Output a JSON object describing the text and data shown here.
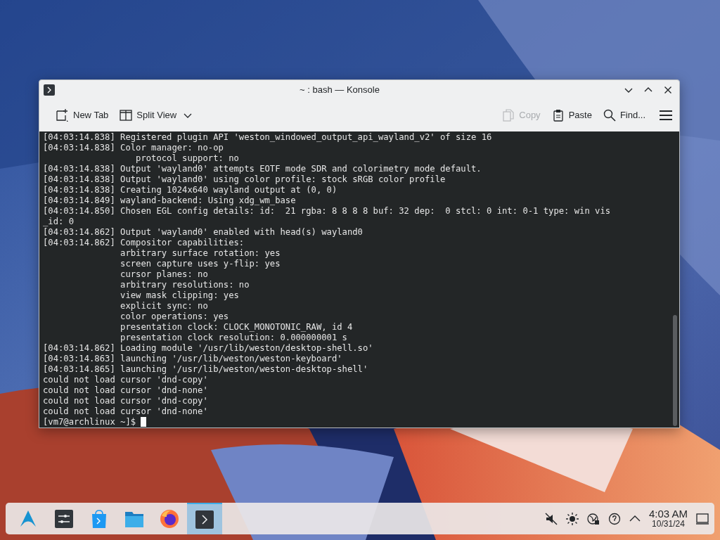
{
  "window": {
    "title": "~ : bash — Konsole"
  },
  "toolbar": [
    {
      "label": "New Tab",
      "disabled": false
    },
    {
      "label": "Split View",
      "disabled": false
    },
    {
      "label": "Copy",
      "disabled": true
    },
    {
      "label": "Paste",
      "disabled": false
    },
    {
      "label": "Find...",
      "disabled": false
    }
  ],
  "terminal": {
    "lines": [
      "[04:03:14.838] Registered plugin API 'weston_windowed_output_api_wayland_v2' of size 16",
      "[04:03:14.838] Color manager: no-op",
      "                  protocol support: no",
      "[04:03:14.838] Output 'wayland0' attempts EOTF mode SDR and colorimetry mode default.",
      "[04:03:14.838] Output 'wayland0' using color profile: stock sRGB color profile",
      "[04:03:14.838] Creating 1024x640 wayland output at (0, 0)",
      "[04:03:14.849] wayland-backend: Using xdg_wm_base",
      "[04:03:14.850] Chosen EGL config details: id:  21 rgba: 8 8 8 8 buf: 32 dep:  0 stcl: 0 int: 0-1 type: win vis",
      "_id: 0",
      "[04:03:14.862] Output 'wayland0' enabled with head(s) wayland0",
      "[04:03:14.862] Compositor capabilities:",
      "               arbitrary surface rotation: yes",
      "               screen capture uses y-flip: yes",
      "               cursor planes: no",
      "               arbitrary resolutions: no",
      "               view mask clipping: yes",
      "               explicit sync: no",
      "               color operations: yes",
      "               presentation clock: CLOCK_MONOTONIC_RAW, id 4",
      "               presentation clock resolution: 0.000000001 s",
      "[04:03:14.862] Loading module '/usr/lib/weston/desktop-shell.so'",
      "[04:03:14.863] launching '/usr/lib/weston/weston-keyboard'",
      "[04:03:14.865] launching '/usr/lib/weston/weston-desktop-shell'",
      "could not load cursor 'dnd-copy'",
      "could not load cursor 'dnd-none'",
      "could not load cursor 'dnd-copy'",
      "could not load cursor 'dnd-none'"
    ],
    "prompt": "[vm7@archlinux ~]$ "
  },
  "taskbar": {
    "apps": [
      {
        "selected": false
      },
      {
        "selected": false
      },
      {
        "selected": false
      },
      {
        "selected": false
      },
      {
        "selected": true
      }
    ],
    "time": "4:03 AM",
    "date": "10/31/24"
  }
}
